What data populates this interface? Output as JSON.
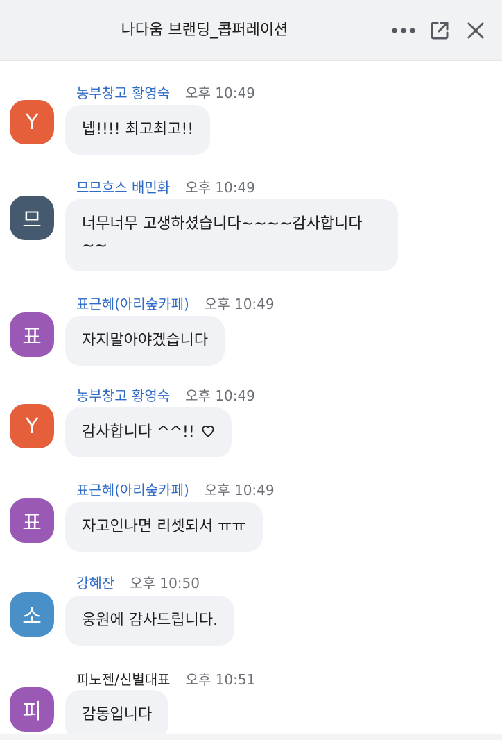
{
  "window": {
    "title": "나다움 브랜딩_콥퍼레이션"
  },
  "header": {
    "more_icon": "more-horizontal-icon",
    "popout_icon": "external-link-icon",
    "close_icon": "close-icon"
  },
  "messages": [
    {
      "sender": "농부창고 황영숙",
      "time": "오후 10:49",
      "avatar_text": "Y",
      "avatar_color": "#e5603a",
      "text": "넵!!!! 최고최고!!",
      "sender_linked": true
    },
    {
      "sender": "므므흐스 배민화",
      "time": "오후 10:49",
      "avatar_text": "므",
      "avatar_color": "#455a6f",
      "text_line1": "너무너무 고생하셨습니다~~~~감사합니다",
      "text_line2": "~~",
      "sender_linked": true
    },
    {
      "sender": "표근혜(아리숲카페)",
      "time": "오후 10:49",
      "avatar_text": "표",
      "avatar_color": "#9b59b6",
      "text": "자지말아야겠습니다",
      "sender_linked": true
    },
    {
      "sender": "농부창고 황영숙",
      "time": "오후 10:49",
      "avatar_text": "Y",
      "avatar_color": "#e5603a",
      "text": "감사합니다 ^^!!",
      "trailing_icon": "heart-outline-icon",
      "sender_linked": true
    },
    {
      "sender": "표근혜(아리숲카페)",
      "time": "오후 10:49",
      "avatar_text": "표",
      "avatar_color": "#9b59b6",
      "text": "자고인나면 리셋되서 ㅠㅠ",
      "sender_linked": true
    },
    {
      "sender": "강혜잔",
      "time": "오후 10:50",
      "avatar_text": "소",
      "avatar_color": "#4a90c8",
      "text": "웅원에 감사드립니다.",
      "sender_linked": true
    },
    {
      "sender": "피노젠/신별대표",
      "time": "오후 10:51",
      "avatar_text": "피",
      "avatar_color": "#9b59b6",
      "text": "감동입니다",
      "sender_linked": false
    }
  ]
}
